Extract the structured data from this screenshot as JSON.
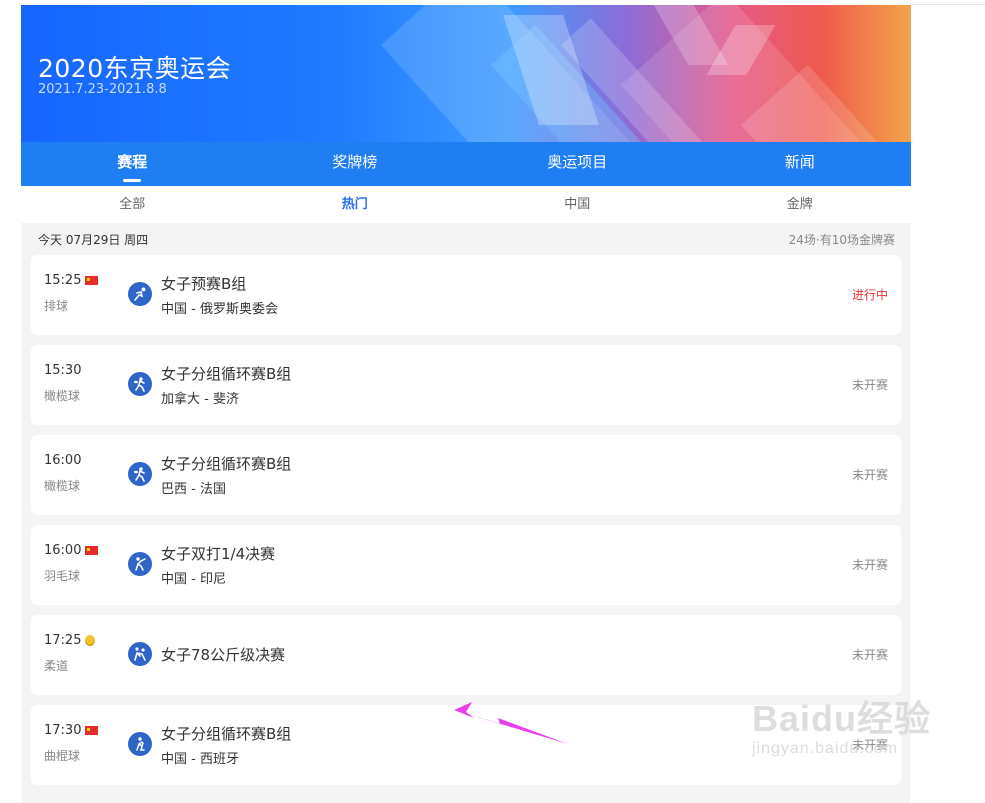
{
  "banner": {
    "title": "2020东京奥运会",
    "dates": "2021.7.23-2021.8.8"
  },
  "tabs": [
    {
      "label": "赛程",
      "active": true
    },
    {
      "label": "奖牌榜",
      "active": false
    },
    {
      "label": "奥运项目",
      "active": false
    },
    {
      "label": "新闻",
      "active": false
    }
  ],
  "subtabs": [
    {
      "label": "全部",
      "active": false
    },
    {
      "label": "热门",
      "active": true
    },
    {
      "label": "中国",
      "active": false
    },
    {
      "label": "金牌",
      "active": false
    }
  ],
  "day": {
    "date": "今天 07月29日 周四",
    "summary": "24场·有10场金牌赛"
  },
  "matches": [
    {
      "time": "15:25",
      "badge": "flag",
      "sport": "排球",
      "icon": "volleyball-icon",
      "event": "女子预赛B组",
      "teams": "中国 - 俄罗斯奥委会",
      "status": "进行中",
      "live": true
    },
    {
      "time": "15:30",
      "badge": "",
      "sport": "橄榄球",
      "icon": "rugby-icon",
      "event": "女子分组循环赛B组",
      "teams": "加拿大 - 斐济",
      "status": "未开赛",
      "live": false
    },
    {
      "time": "16:00",
      "badge": "",
      "sport": "橄榄球",
      "icon": "rugby-icon",
      "event": "女子分组循环赛B组",
      "teams": "巴西 - 法国",
      "status": "未开赛",
      "live": false
    },
    {
      "time": "16:00",
      "badge": "flag",
      "sport": "羽毛球",
      "icon": "badminton-icon",
      "event": "女子双打1/4决赛",
      "teams": "中国 - 印尼",
      "status": "未开赛",
      "live": false
    },
    {
      "time": "17:25",
      "badge": "medal",
      "sport": "柔道",
      "icon": "judo-icon",
      "event": "女子78公斤级决赛",
      "teams": "",
      "status": "未开赛",
      "live": false
    },
    {
      "time": "17:30",
      "badge": "flag",
      "sport": "曲棍球",
      "icon": "hockey-icon",
      "event": "女子分组循环赛B组",
      "teams": "中国 - 西班牙",
      "status": "未开赛",
      "live": false
    }
  ],
  "watermark": {
    "main": "Baidu经验",
    "sub": "jingyan.baidu.com"
  },
  "colors": {
    "nav": "#1f7ef2",
    "live": "#e53030",
    "active_subtab": "#2d6cf0"
  }
}
